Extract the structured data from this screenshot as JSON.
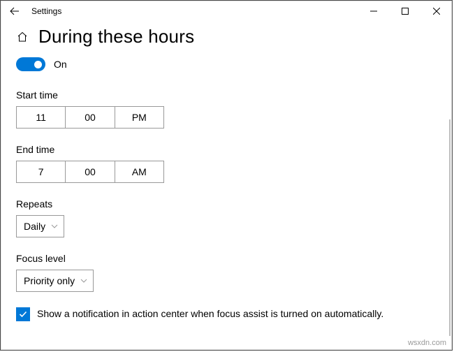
{
  "titlebar": {
    "app_title": "Settings"
  },
  "header": {
    "page_title": "During these hours"
  },
  "toggle": {
    "label": "On",
    "state": true
  },
  "start_time": {
    "label": "Start time",
    "hour": "11",
    "minute": "00",
    "ampm": "PM"
  },
  "end_time": {
    "label": "End time",
    "hour": "7",
    "minute": "00",
    "ampm": "AM"
  },
  "repeats": {
    "label": "Repeats",
    "value": "Daily"
  },
  "focus_level": {
    "label": "Focus level",
    "value": "Priority only"
  },
  "notification_checkbox": {
    "checked": true,
    "label": "Show a notification in action center when focus assist is turned on automatically."
  },
  "watermark": "wsxdn.com"
}
